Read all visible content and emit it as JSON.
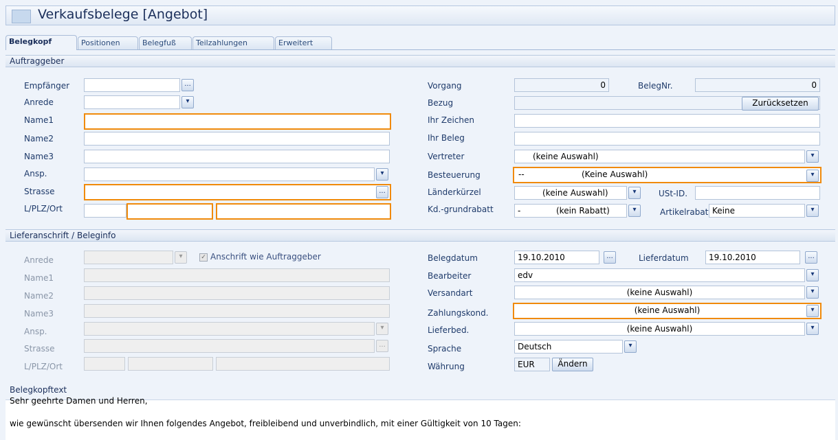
{
  "window": {
    "title": "Verkaufsbelege [Angebot]"
  },
  "tabs": [
    "Belegkopf",
    "Positionen",
    "Belegfuß",
    "Teilzahlungen",
    "Erweitert"
  ],
  "sections": {
    "auftraggeber": "Auftraggeber",
    "lieferanschrift": "Lieferanschrift / Beleginfo",
    "belegkopftext": "Belegkopftext"
  },
  "auftraggeber": {
    "labels": [
      "Empfänger",
      "Anrede",
      "Name1",
      "Name2",
      "Name3",
      "Ansp.",
      "Strasse",
      "L/PLZ/Ort"
    ],
    "empfaenger_value": "",
    "lookup_button": "..."
  },
  "beleg": {
    "vorgang_label": "Vorgang",
    "vorgang_value": "0",
    "belegnr_label": "BelegNr.",
    "belegnr_value": "0",
    "bezug_label": "Bezug",
    "reset_button": "Zurücksetzen",
    "ihr_zeichen_label": "Ihr Zeichen",
    "ihr_beleg_label": "Ihr Beleg",
    "vertreter_label": "Vertreter",
    "vertreter_value": "(keine Auswahl)",
    "besteuerung_label": "Besteuerung",
    "besteuerung_prefix": "--",
    "besteuerung_value": "(Keine Auswahl)",
    "laender_label": "Länderkürzel",
    "laender_value": "(keine Auswahl)",
    "ustid_label": "USt-ID.",
    "rabatt_label": "Kd.-grundrabatt",
    "rabatt_prefix": "-",
    "rabatt_value": "(kein Rabatt)",
    "artikelrabatt_label": "Artikelrabatt",
    "artikelrabatt_value": "Keine"
  },
  "lieferanschrift": {
    "labels": [
      "Anrede",
      "Name1",
      "Name2",
      "Name3",
      "Ansp.",
      "Strasse",
      "L/PLZ/Ort"
    ],
    "checkbox_label": "Anschrift wie Auftraggeber",
    "checkbox_checked": true
  },
  "info": {
    "belegdatum_label": "Belegdatum",
    "belegdatum_value": "19.10.2010",
    "lieferdatum_label": "Lieferdatum",
    "lieferdatum_value": "19.10.2010",
    "bearbeiter_label": "Bearbeiter",
    "bearbeiter_value": "edv",
    "versandart_label": "Versandart",
    "versandart_value": "(keine Auswahl)",
    "zahlung_label": "Zahlungskond.",
    "zahlung_value": "(keine Auswahl)",
    "lieferbed_label": "Lieferbed.",
    "lieferbed_value": "(keine Auswahl)",
    "sprache_label": "Sprache",
    "sprache_value": "Deutsch",
    "waehrung_label": "Währung",
    "waehrung_value": "EUR",
    "aendern_button": "Ändern"
  },
  "belegkopftext": {
    "line1": "Sehr geehrte Damen und Herren,",
    "line2": "wie gewünscht übersenden wir Ihnen folgendes Angebot, freibleibend und unverbindlich, mit einer Gültigkeit von 10 Tagen:"
  },
  "colors": {
    "highlight": "#f08a0a",
    "accent": "#1e3a6a",
    "background": "#eef3fa"
  },
  "icons": {
    "dropdown": "▾",
    "lookup": "...",
    "check": "✓"
  }
}
